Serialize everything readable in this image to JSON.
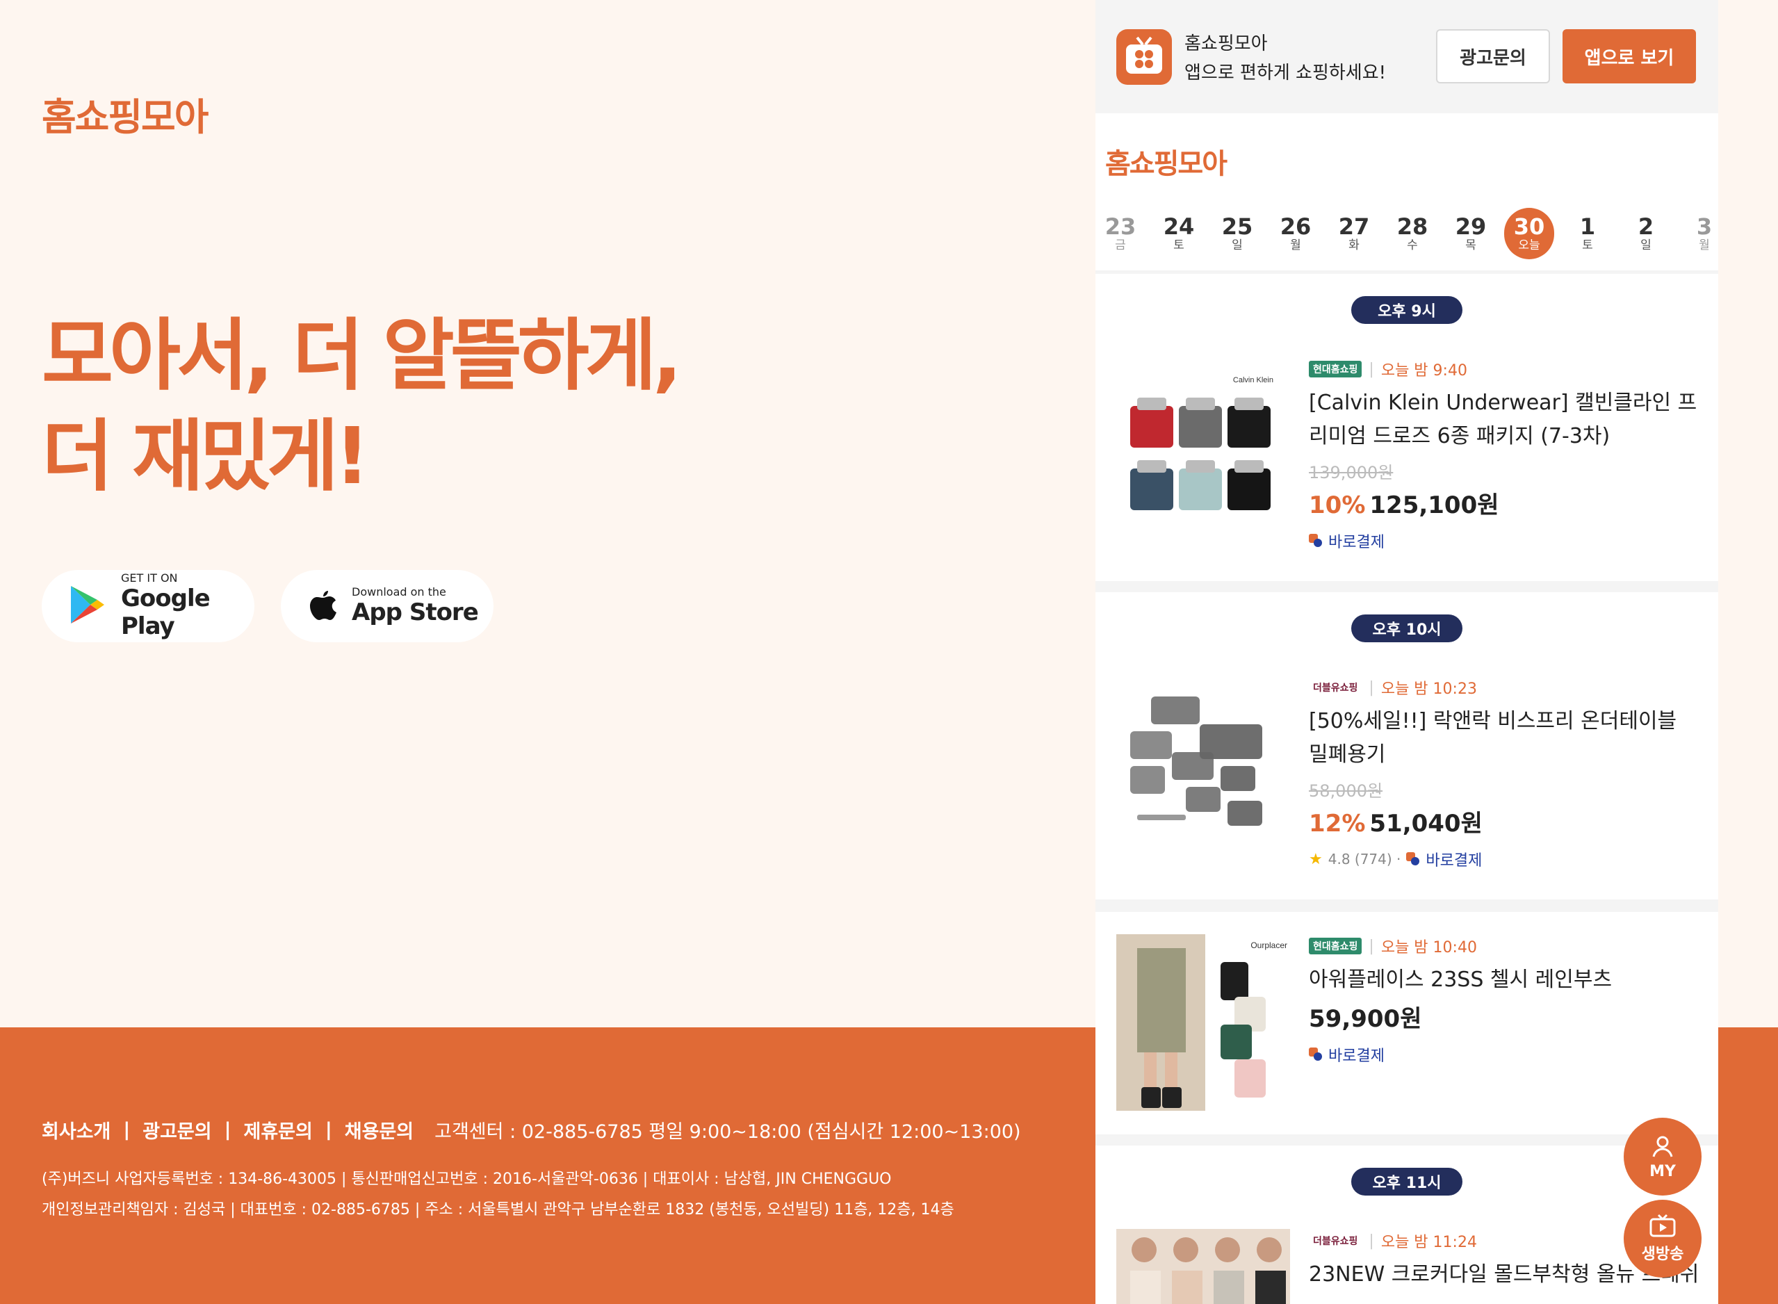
{
  "left": {
    "logo": "홈쇼핑모아",
    "headline_line1": "모아서, 더 알뜰하게,",
    "headline_line2": "더 재밌게!",
    "google_play": {
      "small": "GET IT ON",
      "big": "Google Play"
    },
    "app_store": {
      "small": "Download on the",
      "big": "App Store"
    }
  },
  "footer": {
    "links": [
      "회사소개",
      "광고문의",
      "제휴문의",
      "채용문의"
    ],
    "separator": "|",
    "customer_center": "고객센터 : 02-885-6785 평일 9:00~18:00 (점심시간 12:00~13:00)",
    "info_line1": "(주)버즈니   사업자등록번호 : 134-86-43005 | 통신판매업신고번호 : 2016-서울관악-0636 | 대표이사 : 남상협, JIN CHENGGUO",
    "info_line2": "개인정보관리책임자 : 김성국 | 대표번호 : 02-885-6785 | 주소 : 서울특별시 관악구 남부순환로 1832 (봉천동, 오선빌딩) 11층, 12층, 14층"
  },
  "panel": {
    "banner": {
      "title": "홈쇼핑모아",
      "subtitle": "앱으로 편하게 쇼핑하세요!",
      "ad_button": "광고문의",
      "app_button": "앱으로 보기"
    },
    "logo": "홈쇼핑모아",
    "dates": [
      {
        "num": "23",
        "dow": "금"
      },
      {
        "num": "24",
        "dow": "토"
      },
      {
        "num": "25",
        "dow": "일"
      },
      {
        "num": "26",
        "dow": "월"
      },
      {
        "num": "27",
        "dow": "화"
      },
      {
        "num": "28",
        "dow": "수"
      },
      {
        "num": "29",
        "dow": "목"
      },
      {
        "num": "30",
        "dow": "오늘"
      },
      {
        "num": "1",
        "dow": "토"
      },
      {
        "num": "2",
        "dow": "일"
      },
      {
        "num": "3",
        "dow": "월"
      }
    ],
    "products": [
      {
        "time_slot": "오후 9시",
        "channel": "현대홈쇼핑",
        "air_time": "오늘 밤 9:40",
        "title": "[Calvin Klein Underwear] 캘빈클라인 프리미엄 드로즈 6종 패키지 (7-3차)",
        "thumb_brand": "Calvin Klein",
        "original_price": "139,000원",
        "discount": "10%",
        "price": "125,100원",
        "pay": "바로결제"
      },
      {
        "time_slot": "오후 10시",
        "channel": "더블유쇼핑",
        "air_time": "오늘 밤 10:23",
        "title": "[50%세일!!] 락앤락 비스프리 온더테이블 밀폐용기",
        "original_price": "58,000원",
        "discount": "12%",
        "price": "51,040원",
        "rating": "4.8 (774) ·",
        "pay": "바로결제"
      },
      {
        "channel": "현대홈쇼핑",
        "air_time": "오늘 밤 10:40",
        "title": "아워플레이스 23SS 첼시 레인부츠",
        "thumb_brand": "Ourplacer",
        "price": "59,900원",
        "pay": "바로결제"
      },
      {
        "time_slot": "오후 11시",
        "channel": "더블유쇼핑",
        "air_time": "오늘 밤 11:24",
        "title": "23NEW 크로커다일 몰드부착형 올뉴 프레쉬"
      }
    ],
    "fab_my": "MY",
    "fab_live": "생방송"
  },
  "colors": {
    "accent": "#E06A36",
    "navy": "#232E5C",
    "bg": "#FEF6F0",
    "pay_blue": "#233FA0"
  }
}
